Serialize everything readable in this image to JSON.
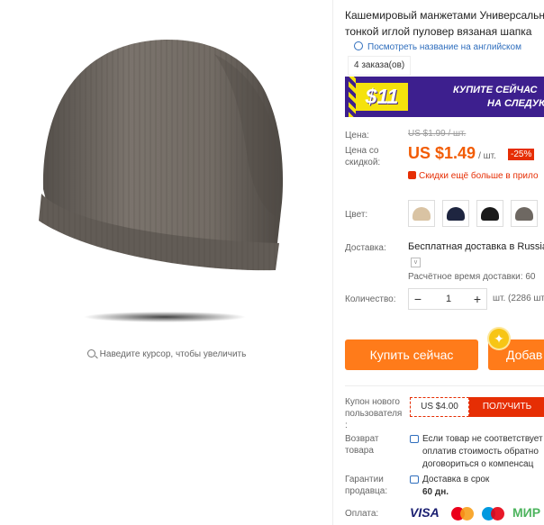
{
  "product": {
    "title_line1": "Кашемировый манжетами Универсальная",
    "title_line2": "тонкой иглой пуловер вязаная шапка",
    "translate_link": "Посмотреть название на английском",
    "orders": "4 заказа(ов)"
  },
  "gallery": {
    "zoom_hint": "Наведите курсор, чтобы увеличить"
  },
  "banner": {
    "price": "$11",
    "line1": "КУПИТЕ СЕЙЧАС",
    "line2": "НА СЛЕДУЮ"
  },
  "price": {
    "label": "Цена:",
    "old": "US $1.99 / шт.",
    "discount_label_1": "Цена со",
    "discount_label_2": "скидкой:",
    "new": "US $1.49",
    "unit": "/ шт.",
    "discount": "-25%",
    "more_discounts": "Скидки ещё больше в прило"
  },
  "colors": {
    "label": "Цвет:",
    "swatches": [
      {
        "name": "beige",
        "color": "#d9c3a3"
      },
      {
        "name": "navy",
        "color": "#1e2540"
      },
      {
        "name": "black",
        "color": "#1a1a1a"
      },
      {
        "name": "gray",
        "color": "#6e6862"
      }
    ]
  },
  "shipping": {
    "label": "Доставка:",
    "value": "Бесплатная доставка в Russia",
    "dropdown": "v",
    "time": "Расчётное время доставки: 60"
  },
  "quantity": {
    "label": "Количество:",
    "minus": "−",
    "value": "1",
    "plus": "+",
    "stock": "шт. (2286 шт"
  },
  "actions": {
    "buy_now": "Купить сейчас",
    "add_to_cart": "Добав"
  },
  "coupon": {
    "label_1": "Купон нового",
    "label_2": "пользователя",
    "label_3": ":",
    "value": "US $4.00",
    "button": "ПОЛУЧИТЬ"
  },
  "returns": {
    "label_1": "Возврат",
    "label_2": "товара",
    "line1": "Если товар не соответствует",
    "line2": "оплатив стоимость обратно",
    "line3": "договориться о компенсац"
  },
  "guarantee": {
    "label_1": "Гарантии",
    "label_2": "продавца:",
    "line1": "Доставка в срок",
    "line2": "60 дн."
  },
  "payment": {
    "label": "Оплата:",
    "visa": "VISA",
    "mir": "МИР"
  }
}
